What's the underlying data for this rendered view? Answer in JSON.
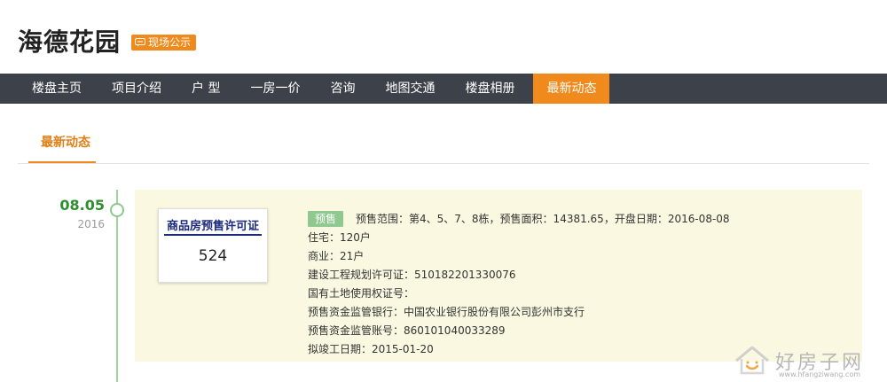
{
  "header": {
    "title": "海德花园",
    "badge_label": "现场公示"
  },
  "nav": {
    "items": [
      {
        "label": "楼盘主页"
      },
      {
        "label": "项目介绍"
      },
      {
        "label": "户 型"
      },
      {
        "label": "一房一价"
      },
      {
        "label": "咨询"
      },
      {
        "label": "地图交通"
      },
      {
        "label": "楼盘相册"
      },
      {
        "label": "最新动态"
      }
    ],
    "active_index": 7
  },
  "section": {
    "title": "最新动态"
  },
  "timeline": {
    "entry": {
      "date": "08.05",
      "year": "2016",
      "permit": {
        "title": "商品房预售许可证",
        "number": "524"
      },
      "tag": "预售",
      "summary": "预售范围：第4、5、7、8栋，预售面积：14381.65，开盘日期：2016-08-08",
      "lines": [
        "住宅：120户",
        "商业：21户",
        "建设工程规划许可证：510182201330076",
        "国有土地使用权证号：",
        "预售资金监管银行：中国农业银行股份有限公司彭州市支行",
        "预售资金监管账号：860101040033289",
        "拟竣工日期：2015-01-20"
      ]
    }
  },
  "watermark": {
    "text": "好房子网",
    "url": "www.hfangziwang.com"
  },
  "colors": {
    "accent": "#f08a1c",
    "nav_bg": "#3d424a",
    "timeline_green": "#2f8f2f",
    "card_bg": "#fbf8e1",
    "permit_blue": "#1d2b7c"
  }
}
